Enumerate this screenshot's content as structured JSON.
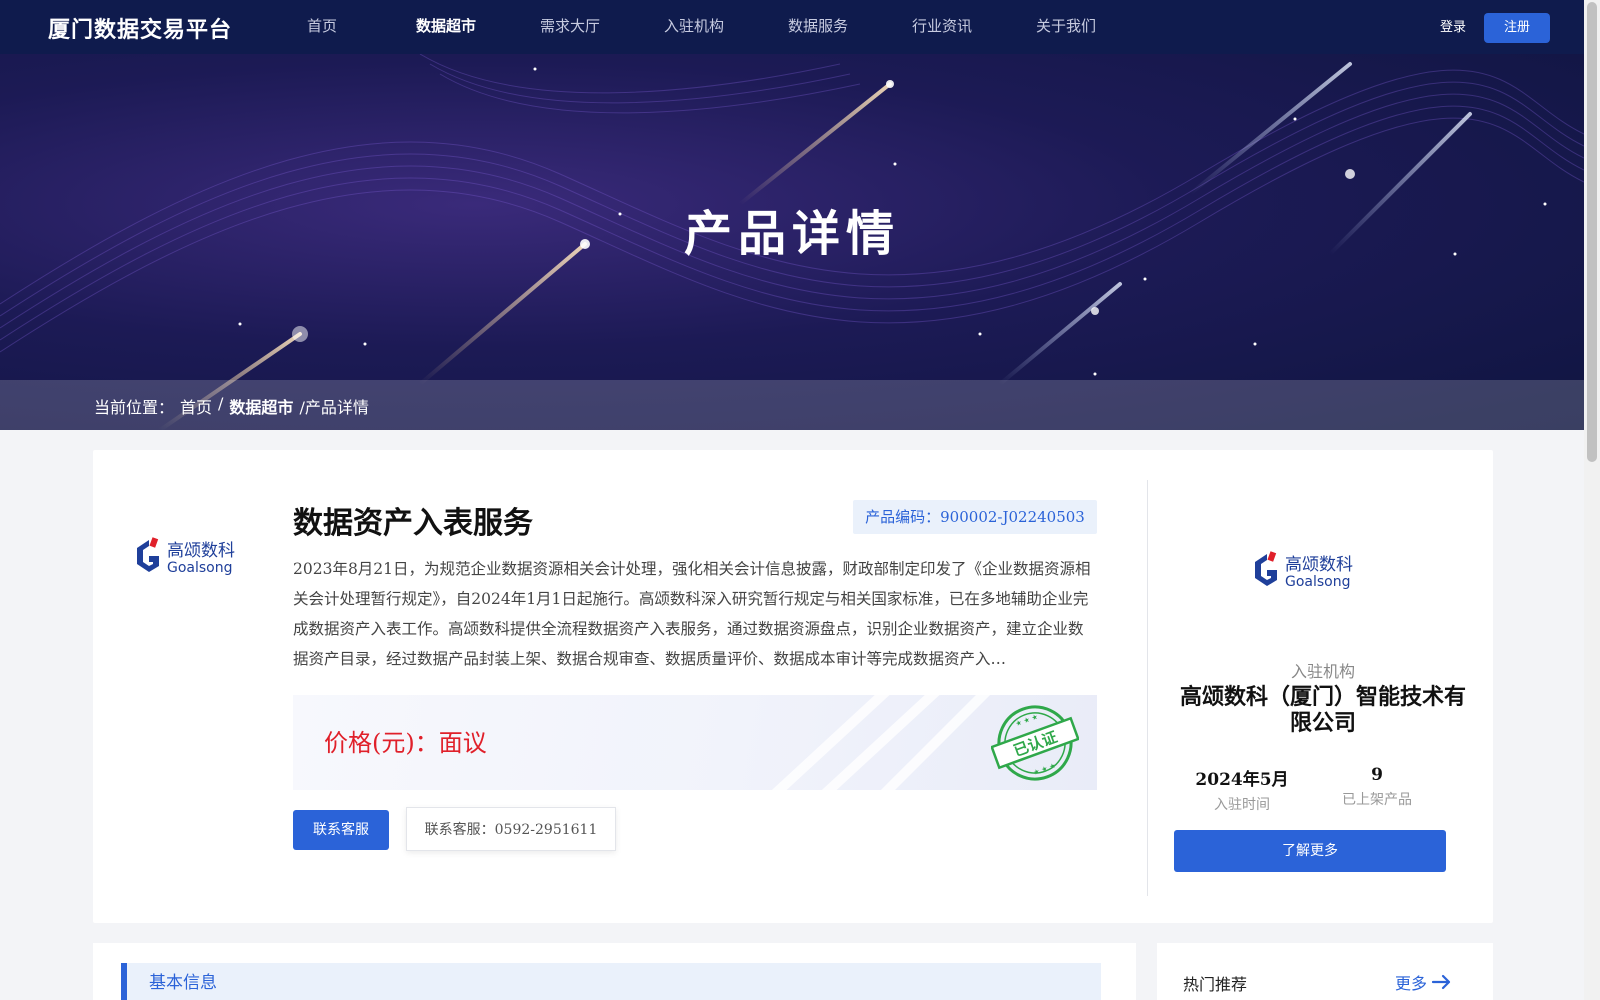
{
  "header": {
    "logo": "厦门数据交易平台",
    "nav": [
      "首页",
      "数据超市",
      "需求大厅",
      "入驻机构",
      "数据服务",
      "行业资讯",
      "关于我们"
    ],
    "active_nav": "数据超市",
    "login": "登录",
    "register": "注册"
  },
  "banner": {
    "title": "产品详情",
    "breadcrumb": {
      "prefix": "当前位置：",
      "home": "首页",
      "sep": "/",
      "market": "数据超市",
      "current": "/产品详情"
    }
  },
  "product": {
    "brand_cn": "高颂数科",
    "brand_en": "Goalsong",
    "title": "数据资产入表服务",
    "code": "产品编码：900002-J02240503",
    "description": "2023年8月21日，为规范企业数据资源相关会计处理，强化相关会计信息披露，财政部制定印发了《企业数据资源相关会计处理暂行规定》，自2024年1月1日起施行。高颂数科深入研究暂行规定与相关国家标准，已在多地辅助企业完成数据资产入表工作。高颂数科提供全流程数据资产入表服务，通过数据资源盘点，识别企业数据资产，建立企业数据资产目录，经过数据产品封装上架、数据合规审查、数据质量评价、数据成本审计等完成数据资产入…",
    "price": "价格(元)：面议",
    "stamp_text": "已认证",
    "contact_button": "联系客服",
    "contact_popup": "联系客服：0592-2951611"
  },
  "organization": {
    "label": "入驻机构",
    "name": "高颂数科（厦门）智能技术有限公司",
    "join_time": "2024年5月",
    "join_time_label": "入驻时间",
    "product_count": "9",
    "product_count_label": "已上架产品",
    "more_button": "了解更多"
  },
  "sections": {
    "basic_info": "基本信息",
    "hot_title": "热门推荐",
    "hot_more": "更多"
  },
  "colors": {
    "brand_blue": "#2b63d8",
    "price_red": "#e0202a",
    "stamp_green": "#2fa84a",
    "header_bg": "#0f1b4d"
  }
}
